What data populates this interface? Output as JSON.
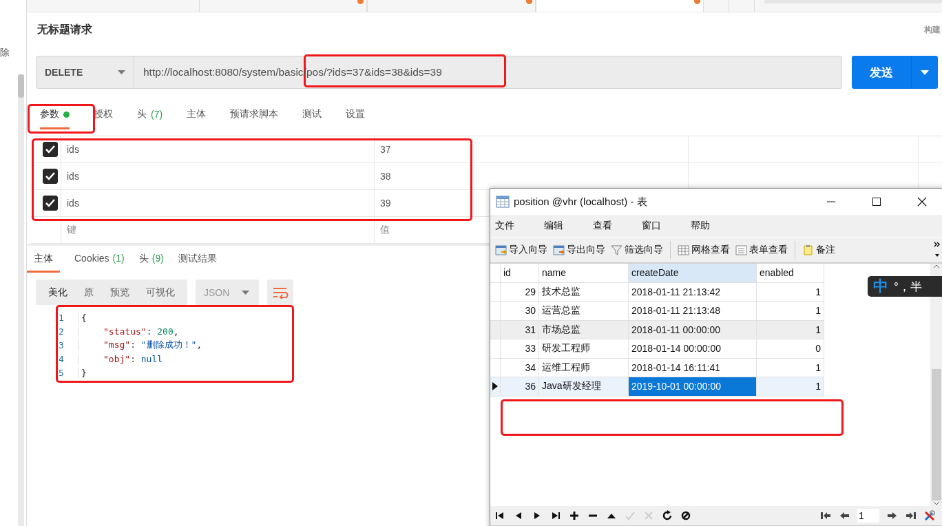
{
  "sidebar": {
    "items": [
      {
        "label": "除"
      }
    ]
  },
  "request": {
    "title": "无标题请求",
    "side_label": "构建",
    "method": "DELETE",
    "url": "http://localhost:8080/system/basic/pos/?ids=37&ids=38&ids=39",
    "send_label": "发送"
  },
  "request_tabs": [
    {
      "label": "参数",
      "selected": true,
      "dot": true
    },
    {
      "label": "授权",
      "selected": false,
      "dot": false
    },
    {
      "label": "头",
      "count": "(7)",
      "selected": false,
      "dot": false
    },
    {
      "label": "主体",
      "selected": false,
      "dot": false
    },
    {
      "label": "预请求脚本",
      "selected": false,
      "dot": false
    },
    {
      "label": "测试",
      "selected": false,
      "dot": false
    },
    {
      "label": "设置",
      "selected": false,
      "dot": false
    }
  ],
  "params": {
    "rows": [
      {
        "checked": true,
        "key": "ids",
        "value": "37"
      },
      {
        "checked": true,
        "key": "ids",
        "value": "38"
      },
      {
        "checked": true,
        "key": "ids",
        "value": "39"
      }
    ],
    "key_placeholder": "键",
    "value_placeholder": "值"
  },
  "response_tabs": [
    {
      "label": "主体",
      "selected": true
    },
    {
      "label": "Cookies",
      "count": "(1)",
      "selected": false
    },
    {
      "label": "头",
      "count": "(9)",
      "selected": false
    },
    {
      "label": "测试结果",
      "selected": false
    }
  ],
  "format_buttons": [
    {
      "label": "美化",
      "selected": true
    },
    {
      "label": "原",
      "selected": false
    },
    {
      "label": "预览",
      "selected": false
    },
    {
      "label": "可视化",
      "selected": false
    }
  ],
  "format_select": "JSON",
  "code_lines": [
    {
      "number": "1",
      "indented": false,
      "tokens": [
        {
          "kind": "punct",
          "text": "{"
        }
      ]
    },
    {
      "number": "2",
      "indented": true,
      "tokens": [
        {
          "kind": "key",
          "text": "\"status\""
        },
        {
          "kind": "punct",
          "text": ": "
        },
        {
          "kind": "num",
          "text": "200"
        },
        {
          "kind": "punct",
          "text": ","
        }
      ]
    },
    {
      "number": "3",
      "indented": true,
      "tokens": [
        {
          "kind": "key",
          "text": "\"msg\""
        },
        {
          "kind": "punct",
          "text": ": "
        },
        {
          "kind": "str",
          "text": "\"删除成功！\""
        },
        {
          "kind": "punct",
          "text": ","
        }
      ]
    },
    {
      "number": "4",
      "indented": true,
      "tokens": [
        {
          "kind": "key",
          "text": "\"obj\""
        },
        {
          "kind": "punct",
          "text": ": "
        },
        {
          "kind": "kw",
          "text": "null"
        }
      ]
    },
    {
      "number": "5",
      "indented": false,
      "tokens": [
        {
          "kind": "punct",
          "text": "}"
        }
      ]
    }
  ],
  "table_window": {
    "title": "position @vhr (localhost) - 表",
    "menu": [
      "文件",
      "编辑",
      "查看",
      "窗口",
      "帮助"
    ],
    "toolbar": [
      {
        "kind": "import",
        "label": "导入向导"
      },
      {
        "kind": "export",
        "label": "导出向导"
      },
      {
        "kind": "filter",
        "label": "筛选向导"
      },
      {
        "kind": "grid",
        "label": "网格查看"
      },
      {
        "kind": "form",
        "label": "表单查看"
      },
      {
        "kind": "note",
        "label": "备注"
      }
    ],
    "columns": [
      {
        "label": "id",
        "focused": false
      },
      {
        "label": "name",
        "focused": false
      },
      {
        "label": "createDate",
        "focused": true
      },
      {
        "label": "enabled",
        "focused": false
      }
    ],
    "rows": [
      {
        "cells": [
          "29",
          "技术总监",
          "2018-01-11 21:13:42",
          "1"
        ],
        "selected": false,
        "highlighted": false
      },
      {
        "cells": [
          "30",
          "运营总监",
          "2018-01-11 21:13:48",
          "1"
        ],
        "selected": false,
        "highlighted": false
      },
      {
        "cells": [
          "31",
          "市场总监",
          "2018-01-11 00:00:00",
          "1"
        ],
        "selected": false,
        "highlighted": true
      },
      {
        "cells": [
          "33",
          "研发工程师",
          "2018-01-14 00:00:00",
          "0"
        ],
        "selected": false,
        "highlighted": false
      },
      {
        "cells": [
          "34",
          "运维工程师",
          "2018-01-14 16:11:41",
          "1"
        ],
        "selected": false,
        "highlighted": false
      },
      {
        "cells": [
          "36",
          "Java研发经理",
          "2019-10-01 00:00:00",
          "1"
        ],
        "selected": true,
        "highlighted": false
      }
    ],
    "page": "1"
  },
  "ime": {
    "mode": "中",
    "rest": "°，半"
  }
}
